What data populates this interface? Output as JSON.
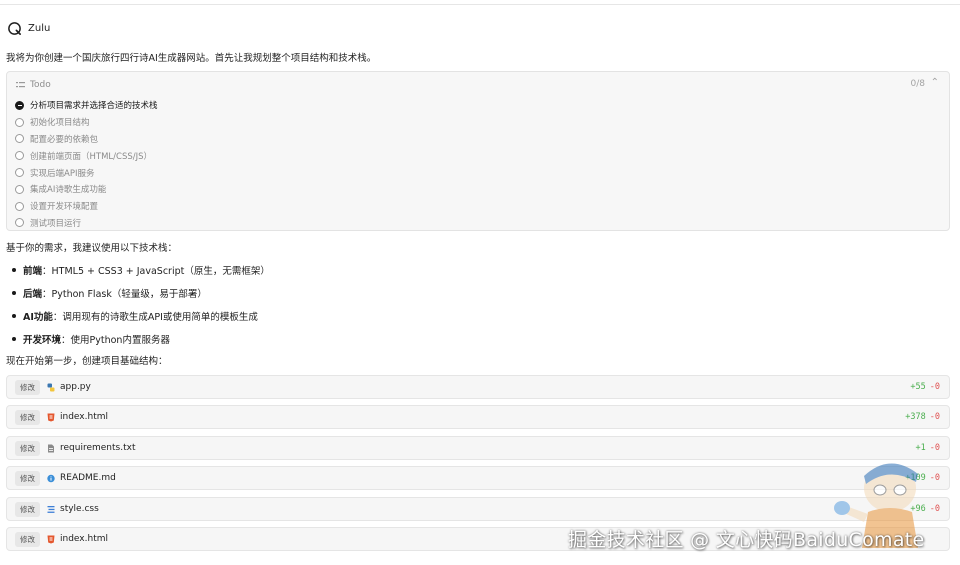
{
  "agent": {
    "name": "Zulu"
  },
  "intro_text": "我将为你创建一个国庆旅行四行诗AI生成器网站。首先让我规划整个项目结构和技术栈。",
  "todo": {
    "title": "Todo",
    "count": "0/8",
    "items": [
      {
        "label": "分析项目需求并选择合适的技术栈",
        "active": true
      },
      {
        "label": "初始化项目结构",
        "active": false
      },
      {
        "label": "配置必要的依赖包",
        "active": false
      },
      {
        "label": "创建前端页面（HTML/CSS/JS）",
        "active": false
      },
      {
        "label": "实现后端API服务",
        "active": false
      },
      {
        "label": "集成AI诗歌生成功能",
        "active": false
      },
      {
        "label": "设置开发环境配置",
        "active": false
      },
      {
        "label": "测试项目运行",
        "active": false
      }
    ]
  },
  "recommend_text": "基于你的需求，我建议使用以下技术栈：",
  "tech_stack": [
    {
      "key": "前端",
      "value": "：HTML5 + CSS3 + JavaScript（原生，无需框架）"
    },
    {
      "key": "后端",
      "value": "：Python Flask（轻量级，易于部署）"
    },
    {
      "key": "AI功能",
      "value": "：调用现有的诗歌生成API或使用简单的模板生成"
    },
    {
      "key": "开发环境",
      "value": "：使用Python内置服务器"
    }
  ],
  "step_text": "现在开始第一步，创建项目基础结构：",
  "file_changes": [
    {
      "tag": "修改",
      "icon": "python-icon",
      "name": "app.py",
      "added": "+55",
      "removed": "-0"
    },
    {
      "tag": "修改",
      "icon": "html-icon",
      "name": "index.html",
      "added": "+378",
      "removed": "-0"
    },
    {
      "tag": "修改",
      "icon": "text-file-icon",
      "name": "requirements.txt",
      "added": "+1",
      "removed": "-0"
    },
    {
      "tag": "修改",
      "icon": "info-icon",
      "name": "README.md",
      "added": "+109",
      "removed": "-0"
    },
    {
      "tag": "修改",
      "icon": "css-icon",
      "name": "style.css",
      "added": "+96",
      "removed": "-0"
    },
    {
      "tag": "修改",
      "icon": "html-icon",
      "name": "index.html",
      "added": "",
      "removed": ""
    }
  ],
  "watermark": "掘金技术社区 @ 文心快码BaiduComate",
  "colors": {
    "added": "#4caf50",
    "removed": "#e05252",
    "panel_bg": "#f6f6f6"
  }
}
